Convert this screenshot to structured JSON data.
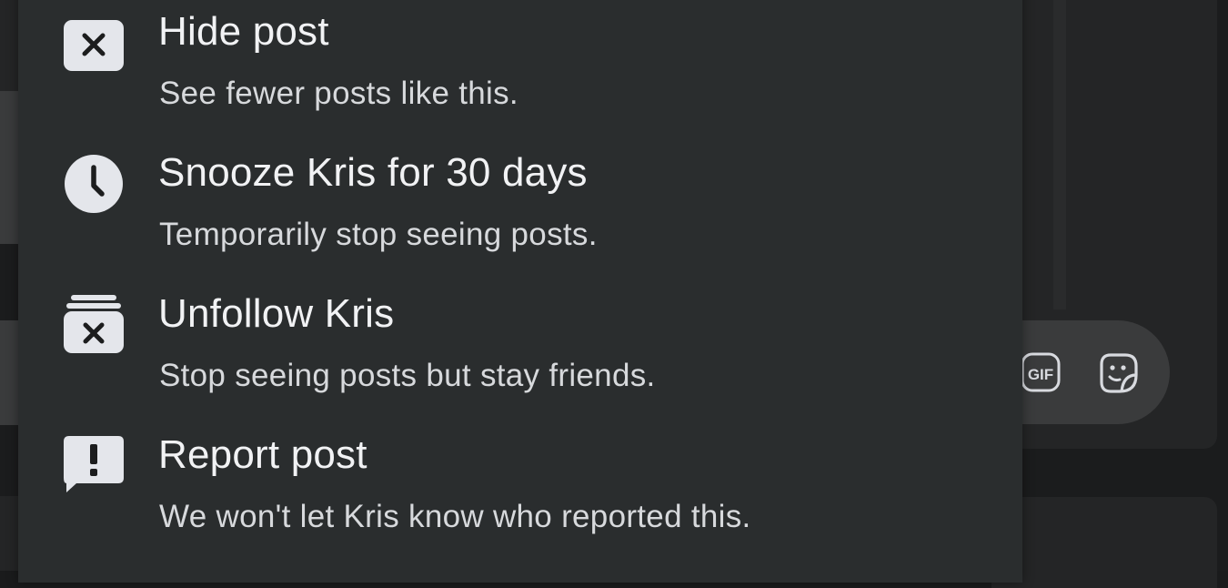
{
  "menu": {
    "items": [
      {
        "icon": "hide-x-icon",
        "title": "Hide post",
        "description": "See fewer posts like this."
      },
      {
        "icon": "clock-icon",
        "title": "Snooze Kris for 30 days",
        "description": "Temporarily stop seeing posts."
      },
      {
        "icon": "unfollow-icon",
        "title": "Unfollow Kris",
        "description": "Stop seeing posts but stay friends."
      },
      {
        "icon": "report-icon",
        "title": "Report post",
        "description": "We won't let Kris know who reported this."
      }
    ]
  },
  "comment_box": {
    "gif_label": "GIF",
    "icons": [
      "gif-icon",
      "sticker-icon"
    ]
  },
  "colors": {
    "menu_background": "#2a2d2e",
    "title_text": "#f1f2f4",
    "description_text": "#d7d9dc",
    "icon_fill": "#e4e6eb"
  }
}
